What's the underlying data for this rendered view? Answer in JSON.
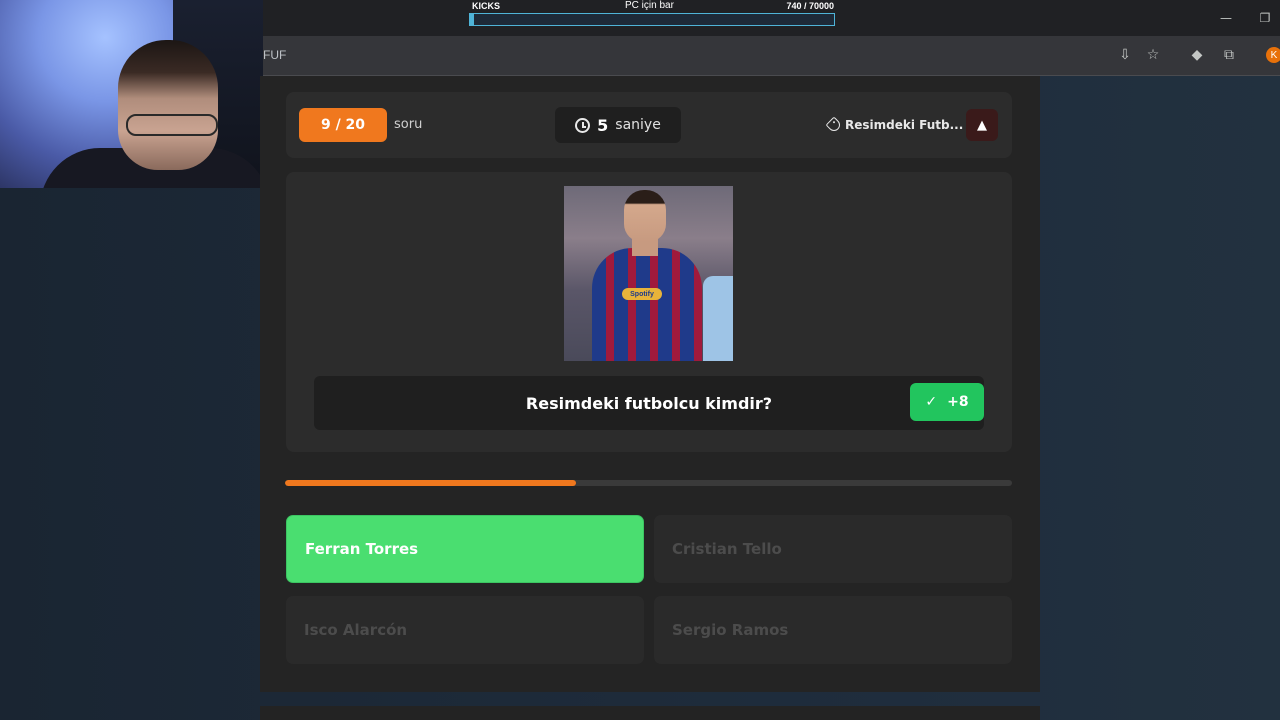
{
  "browser": {
    "address_fragment": "FUF",
    "icons": [
      "install-icon",
      "star-icon",
      "extension-diamond-icon",
      "puzzle-icon"
    ],
    "profile_initial": "K",
    "window_controls": [
      "minimize-icon",
      "restore-icon"
    ]
  },
  "kicks_overlay": {
    "label": "KICKS",
    "title": "PC için bar",
    "count": "740  / 70000",
    "progress_fraction": 0.0106
  },
  "quiz": {
    "question_counter": "9 / 20",
    "counter_suffix": "soru",
    "timer_value": "5",
    "timer_unit": "saniye",
    "category": "Resimdeki Futb...",
    "report_icon": "warning-icon",
    "question": "Resimdeki futbolcu kimdir?",
    "points": "+8",
    "progress_fraction": 0.4,
    "photo": {
      "sponsor_text": "Spotify"
    },
    "answers": [
      {
        "label": "Ferran Torres",
        "state": "correct"
      },
      {
        "label": "Cristian Tello",
        "state": "disabled"
      },
      {
        "label": "Isco Alarcón",
        "state": "disabled"
      },
      {
        "label": "Sergio Ramos",
        "state": "disabled"
      }
    ]
  },
  "colors": {
    "accent_orange": "#f0781e",
    "correct_green": "#4ade70",
    "points_green": "#22c55e",
    "panel": "#242424",
    "card": "#2c2c2c"
  }
}
